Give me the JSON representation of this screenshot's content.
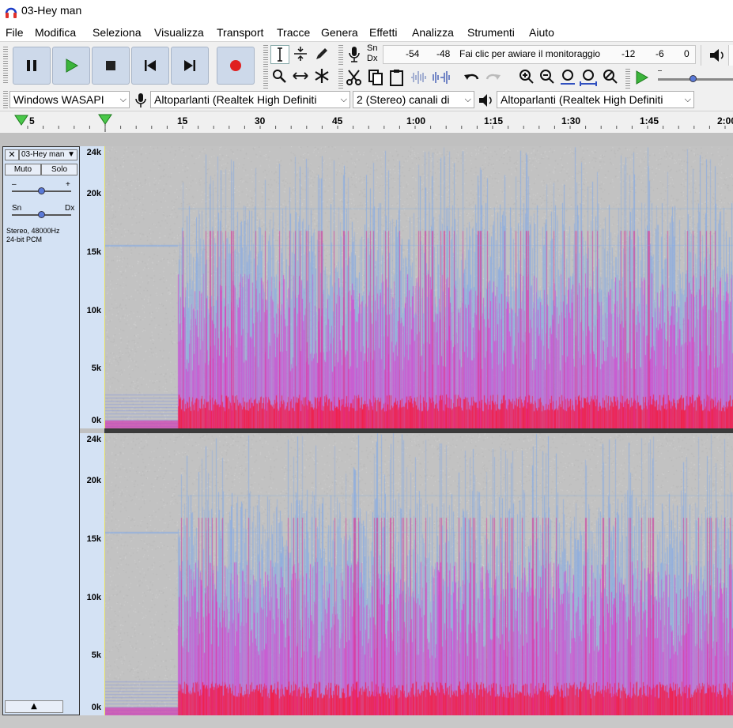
{
  "window": {
    "title": "03-Hey man"
  },
  "menu": [
    "File",
    "Modifica",
    "Seleziona",
    "Visualizza",
    "Transport",
    "Tracce",
    "Genera",
    "Effetti",
    "Analizza",
    "Strumenti",
    "Aiuto"
  ],
  "meter": {
    "channels_top": "Sn",
    "channels_bottom": "Dx",
    "scale": [
      "-54",
      "-48",
      "-12",
      "-6",
      "0"
    ],
    "monitor_text": "Fai clic per awiare il monitoraggio"
  },
  "device_bar": {
    "host": "Windows WASAPI",
    "recording_device": "Altoparlanti (Realtek High Definiti",
    "channels": "2 (Stereo) canali di",
    "playback_device": "Altoparlanti (Realtek High Definiti"
  },
  "ruler": {
    "labels": [
      "5",
      "15",
      "30",
      "45",
      "1:00",
      "1:15",
      "1:30",
      "1:45",
      "2:00"
    ]
  },
  "track": {
    "name": "03-Hey man",
    "mute": "Muto",
    "solo": "Solo",
    "gain_minus": "–",
    "gain_plus": "+",
    "pan_left": "Sn",
    "pan_right": "Dx",
    "info_line1": "Stereo, 48000Hz",
    "info_line2": "24-bit PCM",
    "freq_labels": [
      "24k",
      "20k",
      "15k",
      "10k",
      "5k",
      "0k"
    ]
  },
  "colors": {
    "spectro_bg": "#c2c2c2",
    "spectro_blue": "#7fa8e8",
    "spectro_magenta": "#d840d0",
    "spectro_red": "#f0204a",
    "panel": "#d4e2f4",
    "play_green": "#3cb43c",
    "record_red": "#e02020"
  }
}
